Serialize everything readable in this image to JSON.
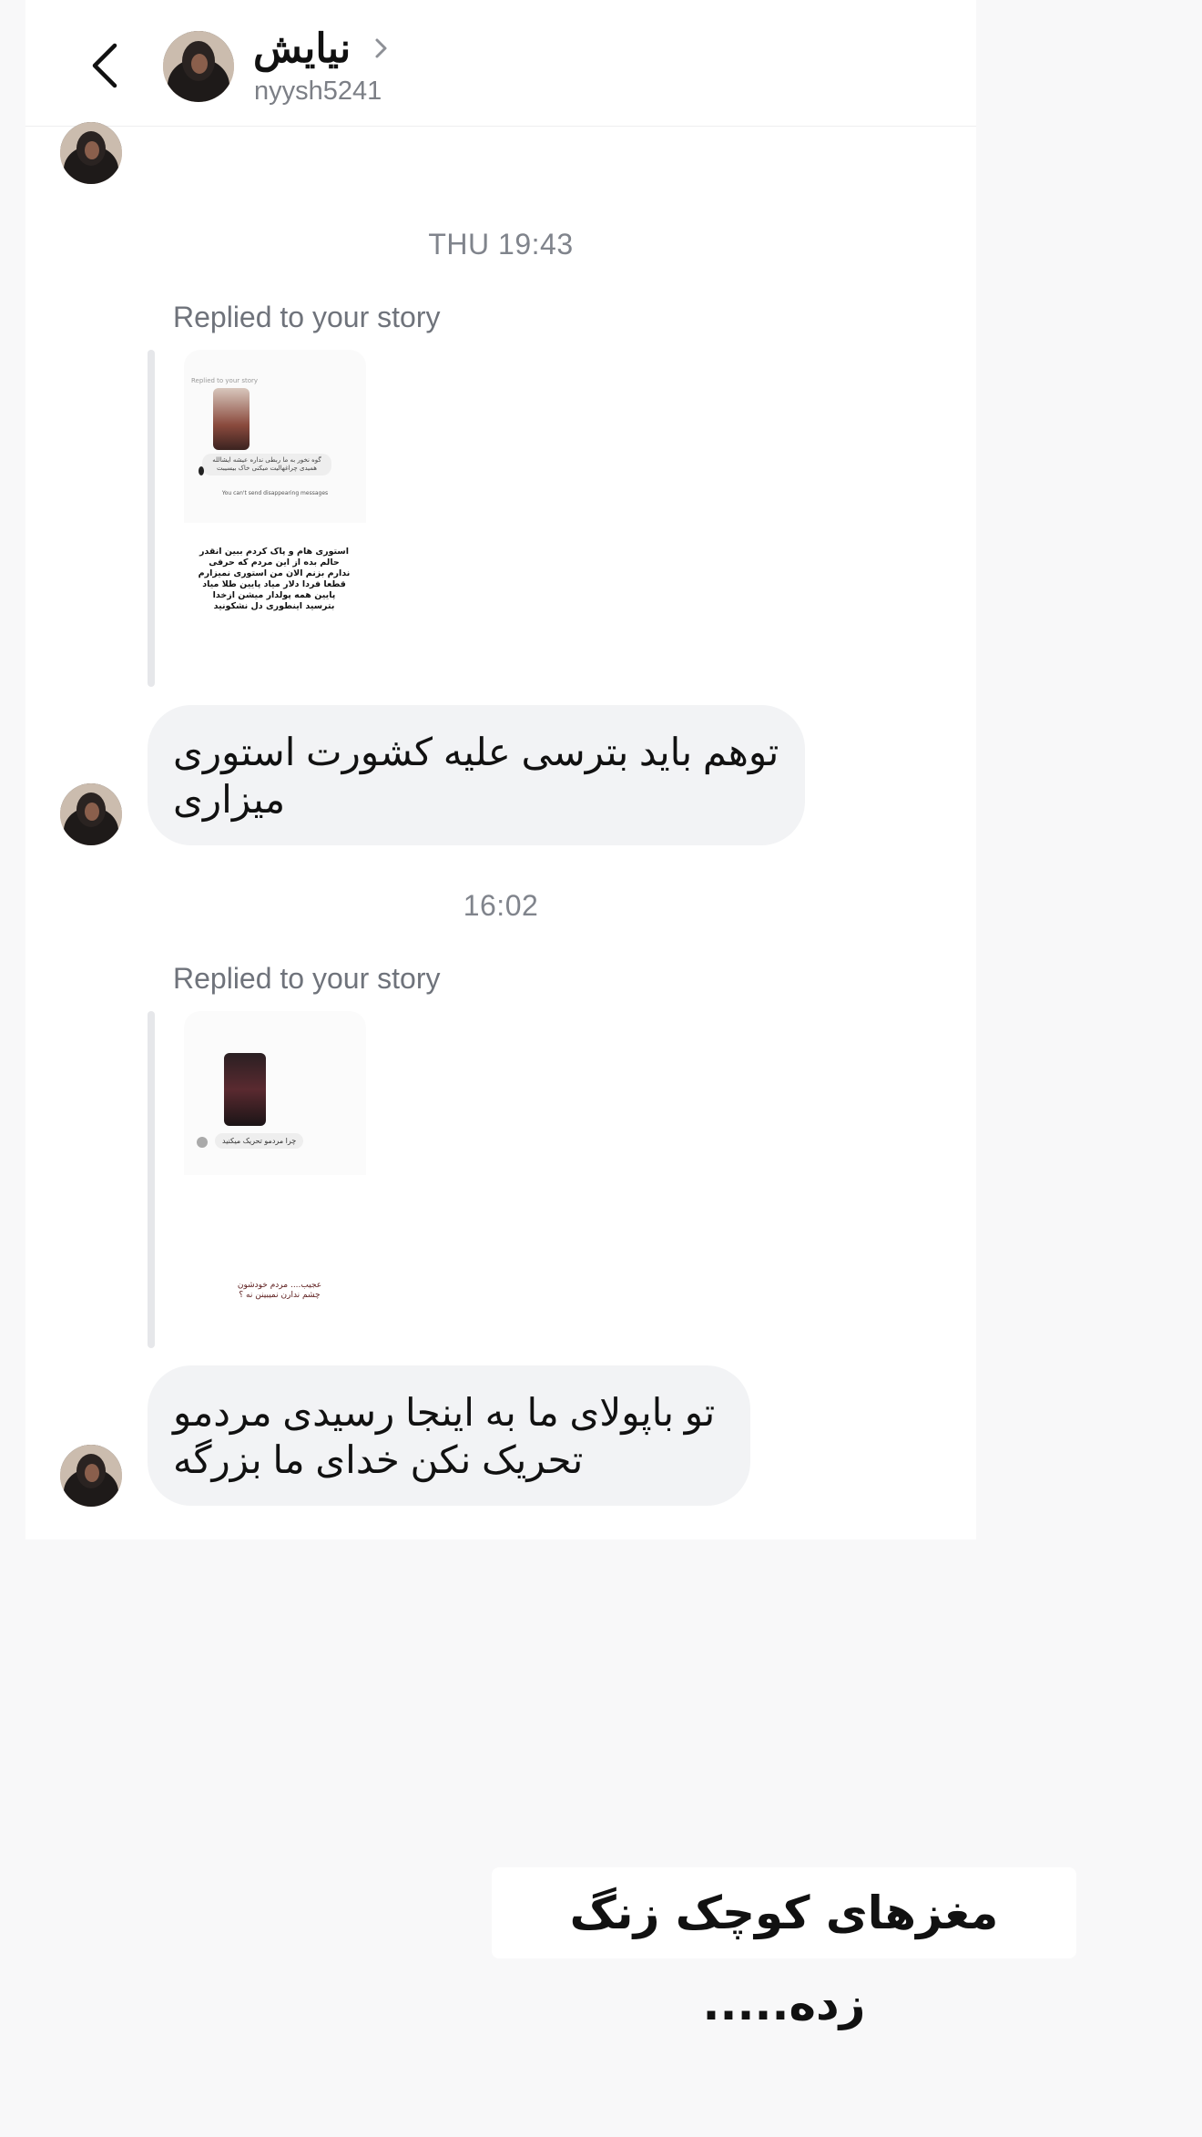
{
  "header": {
    "name": "نیایش",
    "username": "nyysh5241"
  },
  "thread": {
    "timestamp_1": "THU 19:43",
    "replied_label_1": "Replied to your story",
    "story_1": {
      "top_text": "Replied to your story",
      "reply_text": "گوه نخور به ما ربطی نداره عیشه ایشالله همیدی چراغهالیت میکنی خاک بیسیبت",
      "notice": "You can't send disappearing messages",
      "story_text": "استوری هام و پاک کردم ببین انقدر حالم بده از این مردم که حرفی ندارم بزنم الان من استوری نمیزارم قطعا فردا دلار میاد پایین طلا میاد پایین همه پولدار میشن ازخدا بترسید اینطوری دل نشکونید"
    },
    "message_1": "توهم باید بترسی علیه کشورت استوری میزاری",
    "timestamp_2": "16:02",
    "replied_label_2": "Replied to your story",
    "story_2": {
      "reply_text": "چرا مردمو تحریک میکنید",
      "story_text": "عجیب.... مردم خودشون چشم ندارن نمیبینن نه ؟"
    },
    "message_2": "تو باپولای ما به اینجا رسیدی مردمو تحریک نکن خدای ما بزرگه"
  },
  "caption": "مغزهای کوچک زنگ زده....."
}
